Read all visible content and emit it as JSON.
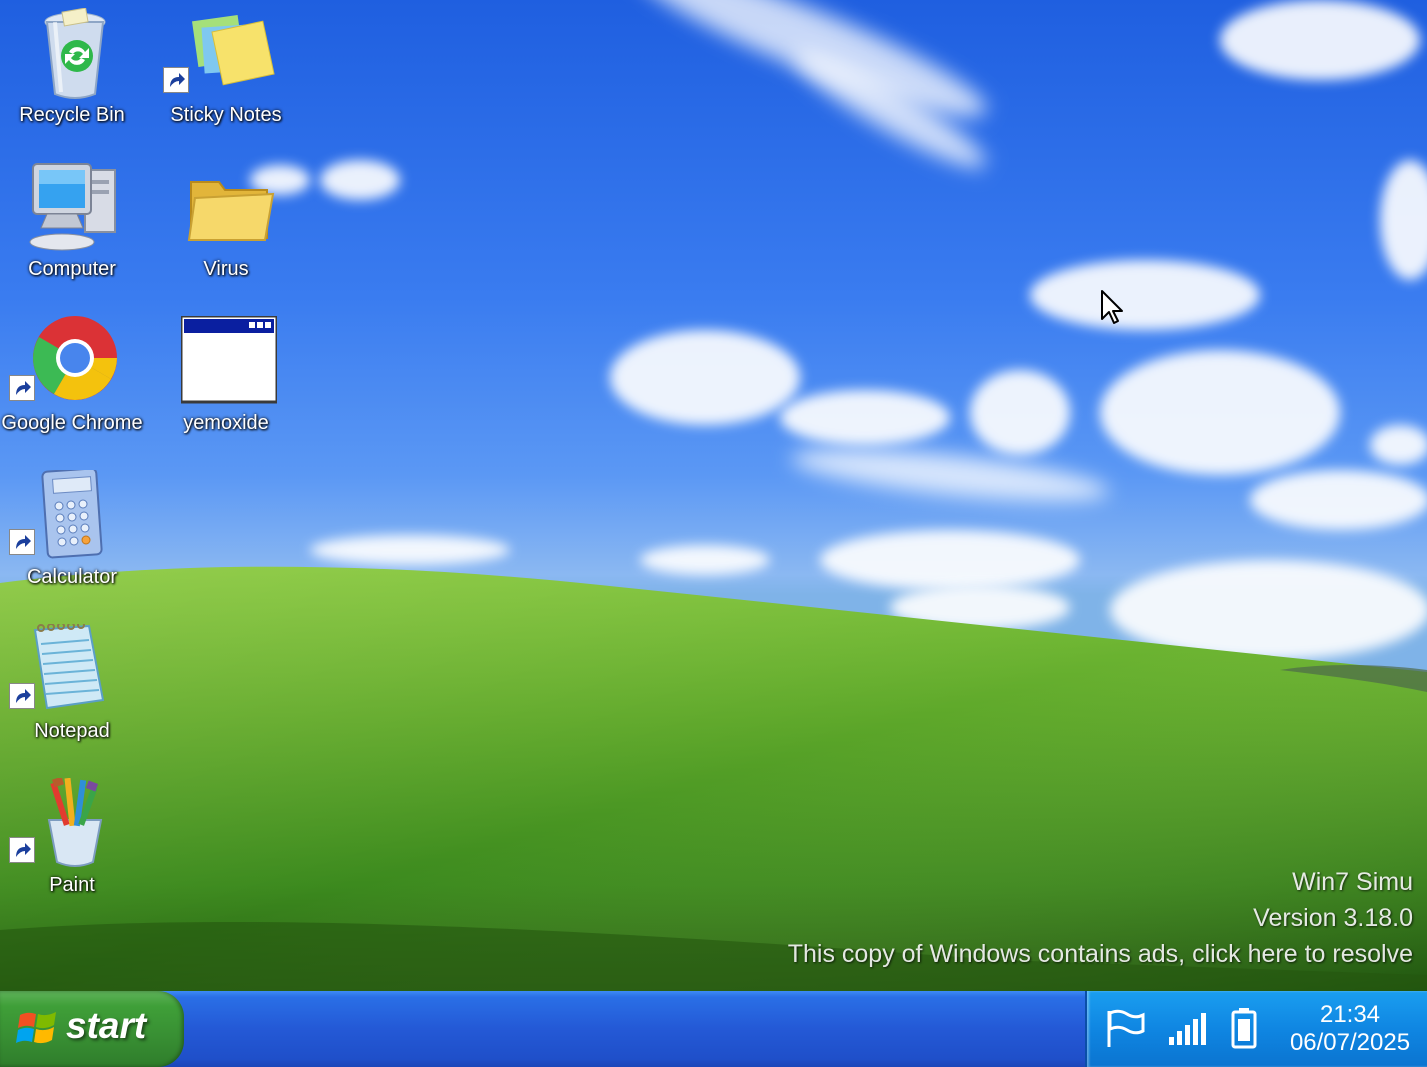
{
  "desktop": {
    "icons": [
      {
        "label": "Recycle Bin",
        "icon": "recycle-bin-icon"
      },
      {
        "label": "Sticky Notes",
        "icon": "sticky-notes-icon"
      },
      {
        "label": "Computer",
        "icon": "computer-icon"
      },
      {
        "label": "Virus",
        "icon": "folder-icon"
      },
      {
        "label": "Google Chrome",
        "icon": "chrome-icon"
      },
      {
        "label": "yemoxide",
        "icon": "window-icon"
      },
      {
        "label": "Calculator",
        "icon": "calculator-icon"
      },
      {
        "label": "Notepad",
        "icon": "notepad-icon"
      },
      {
        "label": "Paint",
        "icon": "paint-icon"
      }
    ],
    "watermark": {
      "line1": "Win7 Simu",
      "line2": "Version 3.18.0",
      "line3": "This copy of Windows contains ads, click here to resolve"
    }
  },
  "taskbar": {
    "start_label": "start",
    "tray": {
      "icons": [
        "flag-icon",
        "signal-icon",
        "battery-icon"
      ],
      "time": "21:34",
      "date": "06/07/2025"
    }
  },
  "colors": {
    "taskbar_blue": "#2459d6",
    "start_green": "#3f9f38",
    "tray_blue": "#0f86e2"
  }
}
